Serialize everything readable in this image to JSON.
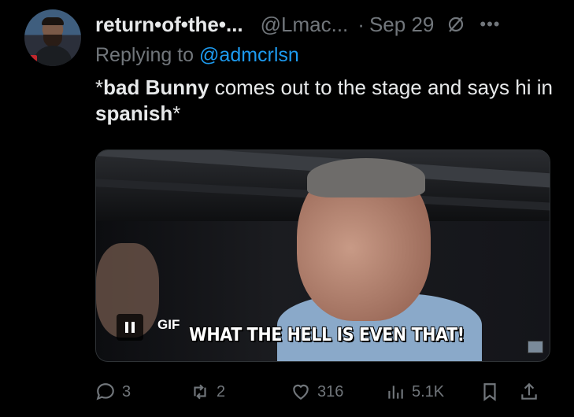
{
  "author": {
    "display_name": "return•of•the•...",
    "handle": "@Lmac...",
    "separator": "·",
    "date": "Sep 29",
    "more_label": "•••"
  },
  "reply": {
    "prefix": "Replying to ",
    "mention": "@admcrlsn"
  },
  "tweet": {
    "part1": "*",
    "bold1": "bad Bunny",
    "part2": " comes out to the stage and says hi in ",
    "bold2": "spanish",
    "part3": "*"
  },
  "media": {
    "caption": "WHAT THE HELL IS EVEN THAT!",
    "gif_label": "GIF"
  },
  "actions": {
    "replies": "3",
    "reposts": "2",
    "likes": "316",
    "views": "5.1K"
  },
  "colors": {
    "background": "#000000",
    "text": "#e7e9ea",
    "muted": "#71767b",
    "accent": "#1d9bf0"
  }
}
